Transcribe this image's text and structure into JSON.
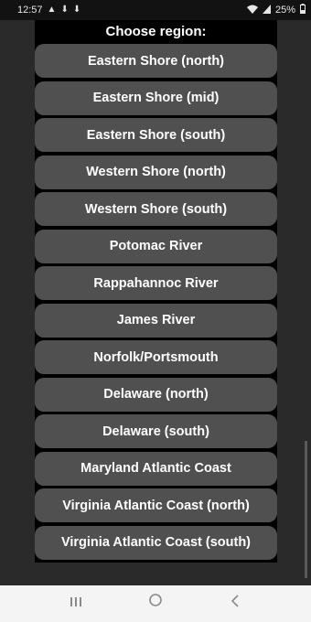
{
  "status_bar": {
    "time": "12:57",
    "left_icons": [
      "warning-icon",
      "download-icon",
      "download-icon"
    ],
    "battery": "25%"
  },
  "dialog": {
    "title": "Choose region:",
    "regions": [
      "Eastern Shore (north)",
      "Eastern Shore (mid)",
      "Eastern Shore (south)",
      "Western Shore (north)",
      "Western Shore (south)",
      "Potomac River",
      "Rappahannoc River",
      "James River",
      "Norfolk/Portsmouth",
      "Delaware (north)",
      "Delaware (south)",
      "Maryland Atlantic Coast",
      "Virginia Atlantic Coast (north)",
      "Virginia Atlantic Coast (south)"
    ]
  },
  "nav_bar": {
    "buttons": [
      "recents-icon",
      "home-icon",
      "back-icon"
    ]
  },
  "colors": {
    "background": "#2a2a2a",
    "dialog": "#000000",
    "item": "#505050",
    "text": "#ffffff"
  }
}
